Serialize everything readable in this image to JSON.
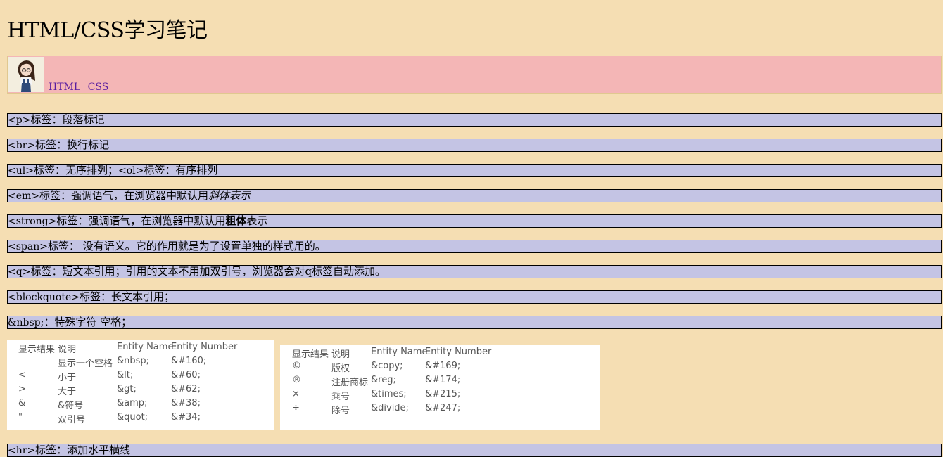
{
  "page_title": "HTML/CSS学习笔记",
  "nav": {
    "links": [
      "HTML",
      "CSS"
    ]
  },
  "notes": [
    {
      "code": "<p>",
      "text": "标签：段落标记"
    },
    {
      "code": "<br>",
      "text": "标签：换行标记"
    },
    {
      "code": "<ul>",
      "text": "标签：无序排列；",
      "code2": "<ol>",
      "text2": "标签：有序排列"
    },
    {
      "code": "<em>",
      "text": "标签：强调语气，在浏览器中默认用",
      "em": "斜体表示"
    },
    {
      "code": "<strong>",
      "text": "标签：强调语气，在浏览器中默认用",
      "strong": "粗体",
      "text_after": "表示"
    },
    {
      "code": "<span>",
      "text": "标签： 没有语义。它的作用就是为了设置单独的样式用的。"
    },
    {
      "code": "<q>",
      "text": "标签：短文本引用；引用的文本不用加双引号，浏览器会对q标签自动添加。"
    },
    {
      "code": "<blockquote>",
      "text": "标签：长文本引用；"
    },
    {
      "code": "&nbsp;",
      "text": "：特殊字符 空格；"
    },
    {
      "code": "<hr>",
      "text": "标签：添加水平横线"
    }
  ],
  "entity_tables": [
    {
      "headers": [
        "显示结果",
        "说明",
        "Entity Name",
        "Entity Number"
      ],
      "rows": [
        [
          "",
          "显示一个空格",
          "&nbsp;",
          "&#160;"
        ],
        [
          "<",
          "小于",
          "&lt;",
          "&#60;"
        ],
        [
          ">",
          "大于",
          "&gt;",
          "&#62;"
        ],
        [
          "&",
          "&符号",
          "&amp;",
          "&#38;"
        ],
        [
          "\"",
          "双引号",
          "&quot;",
          "&#34;"
        ]
      ]
    },
    {
      "headers": [
        "显示结果",
        "说明",
        "Entity Name",
        "Entity Number"
      ],
      "rows": [
        [
          "©",
          "版权",
          "&copy;",
          "&#169;"
        ],
        [
          "®",
          "注册商标",
          "&reg;",
          "&#174;"
        ],
        [
          "×",
          "乘号",
          "&times;",
          "&#215;"
        ],
        [
          "÷",
          "除号",
          "&divide;",
          "&#247;"
        ]
      ]
    }
  ]
}
